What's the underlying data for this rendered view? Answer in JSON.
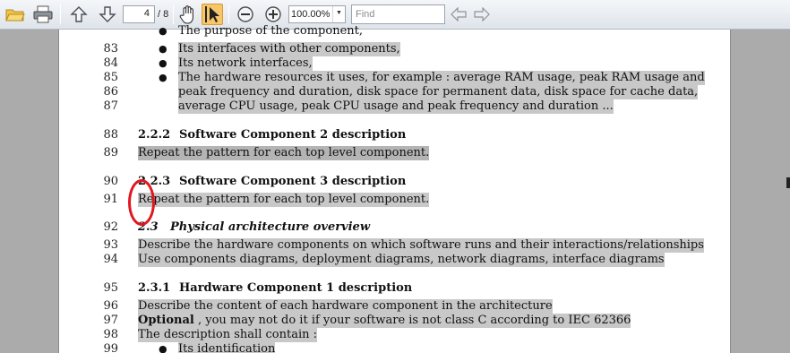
{
  "toolbar": {
    "page_current": "4",
    "page_total": "/ 8",
    "zoom": "100.00%",
    "find_placeholder": "Find",
    "icons": [
      "open-folder-icon",
      "print-icon",
      "arrow-up-icon",
      "arrow-down-icon",
      "hand-tool-icon",
      "select-tool-icon",
      "zoom-out-icon",
      "zoom-in-icon",
      "find-prev-icon",
      "find-next-icon"
    ]
  },
  "document": {
    "lines": [
      {
        "num": "83",
        "text": "Its interfaces with other components,"
      },
      {
        "num": "84",
        "text": "Its network interfaces,"
      },
      {
        "num": "85",
        "text": "The hardware resources it uses, for example : average RAM usage, peak RAM usage and"
      },
      {
        "num": "86",
        "text": "peak frequency and duration, disk space for permanent data, disk space for cache data,"
      },
      {
        "num": "87",
        "text": "average CPU usage, peak CPU usage and peak frequency and duration ..."
      },
      {
        "num": "88",
        "sec": "2.2.2",
        "text": "Software Component 2 description"
      },
      {
        "num": "89",
        "text": "Repeat the pattern for each top level component."
      },
      {
        "num": "90",
        "sec": "2.2.3",
        "text": "Software Component 3 description"
      },
      {
        "num": "91",
        "text": "Repeat the pattern for each top level component."
      },
      {
        "num": "92",
        "sec": "2.3",
        "text": "Physical architecture overview"
      },
      {
        "num": "93",
        "text": "Describe the hardware components on which software runs and their interactions/relationships"
      },
      {
        "num": "94",
        "text": "Use components diagrams, deployment diagrams, network diagrams, interface diagrams"
      },
      {
        "num": "95",
        "sec": "2.3.1",
        "text": "Hardware Component 1 description"
      },
      {
        "num": "96",
        "text": "Describe the content of each hardware component in the architecture"
      },
      {
        "num": "97",
        "bold": "Optional",
        "text": " , you may not do it if your software is not class C according to IEC 62366"
      },
      {
        "num": "98",
        "text": "The description shall contain :"
      },
      {
        "num": "99",
        "text": "Its identification"
      }
    ],
    "top_partial": "The purpose of the component,"
  },
  "colors": {
    "highlight": "#c8c8c8",
    "annotation": "#e0171f"
  }
}
